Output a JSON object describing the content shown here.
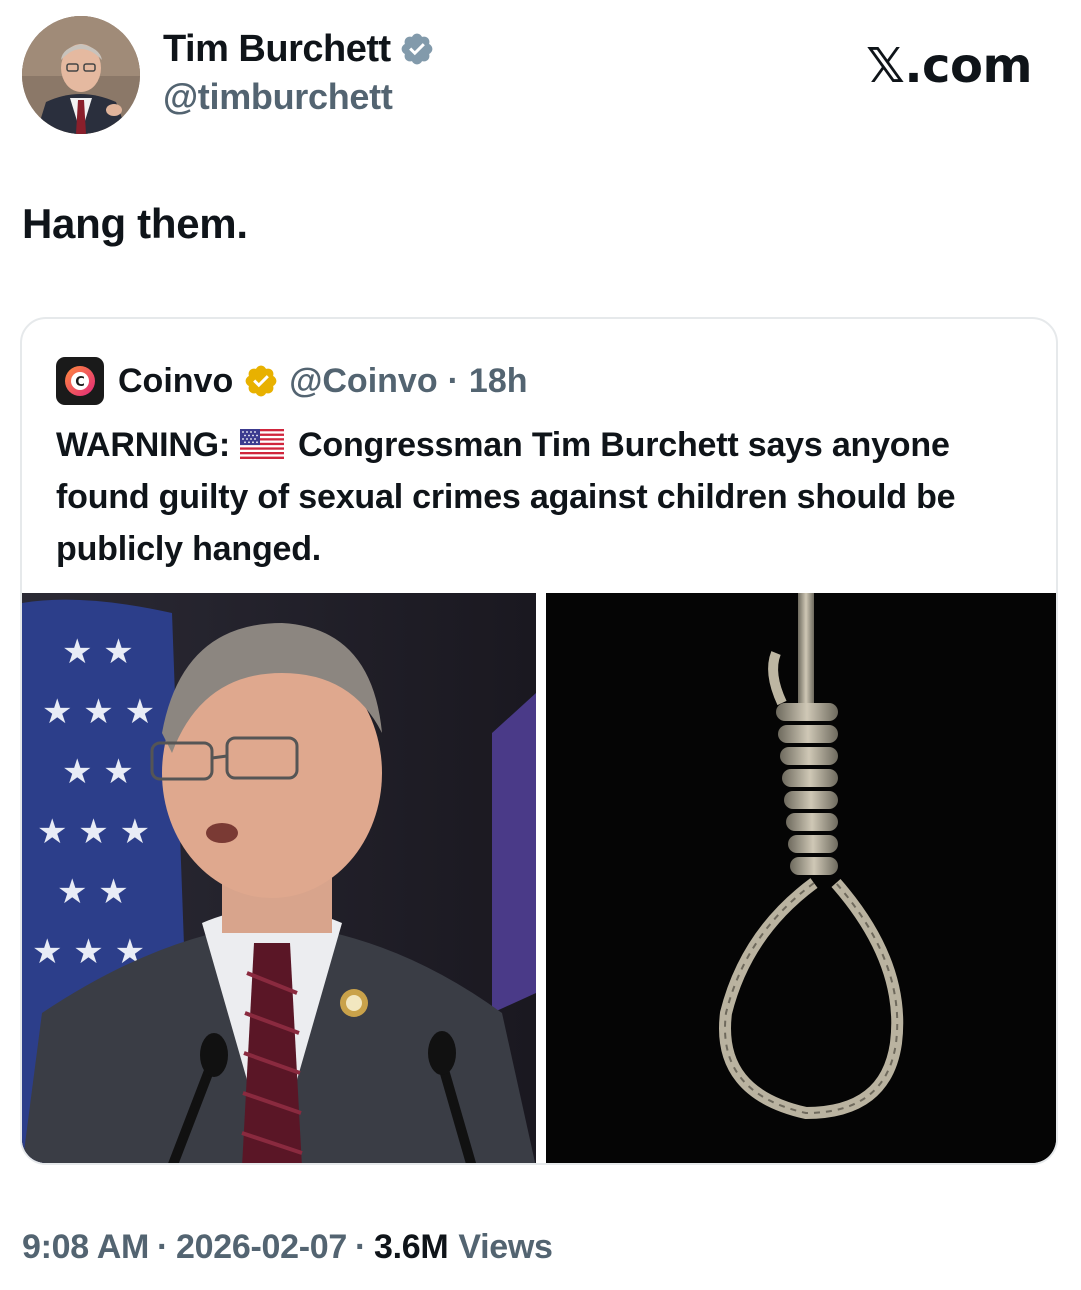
{
  "author": {
    "name": "Tim Burchett",
    "handle": "@timburchett",
    "verified_color": "#829aab"
  },
  "brand": {
    "label": "𝕏.com"
  },
  "tweet": {
    "text": "Hang them."
  },
  "quote": {
    "name": "Coinvo",
    "handle": "@Coinvo",
    "separator": "·",
    "time": "18h",
    "verified_color": "#e8b100",
    "text_before_flag": "WARNING:",
    "text_after_flag": "Congressman Tim Burchett says anyone found guilty of sexual crimes against children should be publicly hanged."
  },
  "footer": {
    "time": "9:08 AM",
    "sep1": "·",
    "date": "2026-02-07",
    "sep2": "·",
    "views_count": "3.6M",
    "views_label": "Views"
  },
  "icons": {
    "author_verified": "verified-badge-icon",
    "quote_verified": "verified-badge-icon",
    "quote_logo": "coinvo-logo-icon",
    "flag": "us-flag-icon"
  }
}
